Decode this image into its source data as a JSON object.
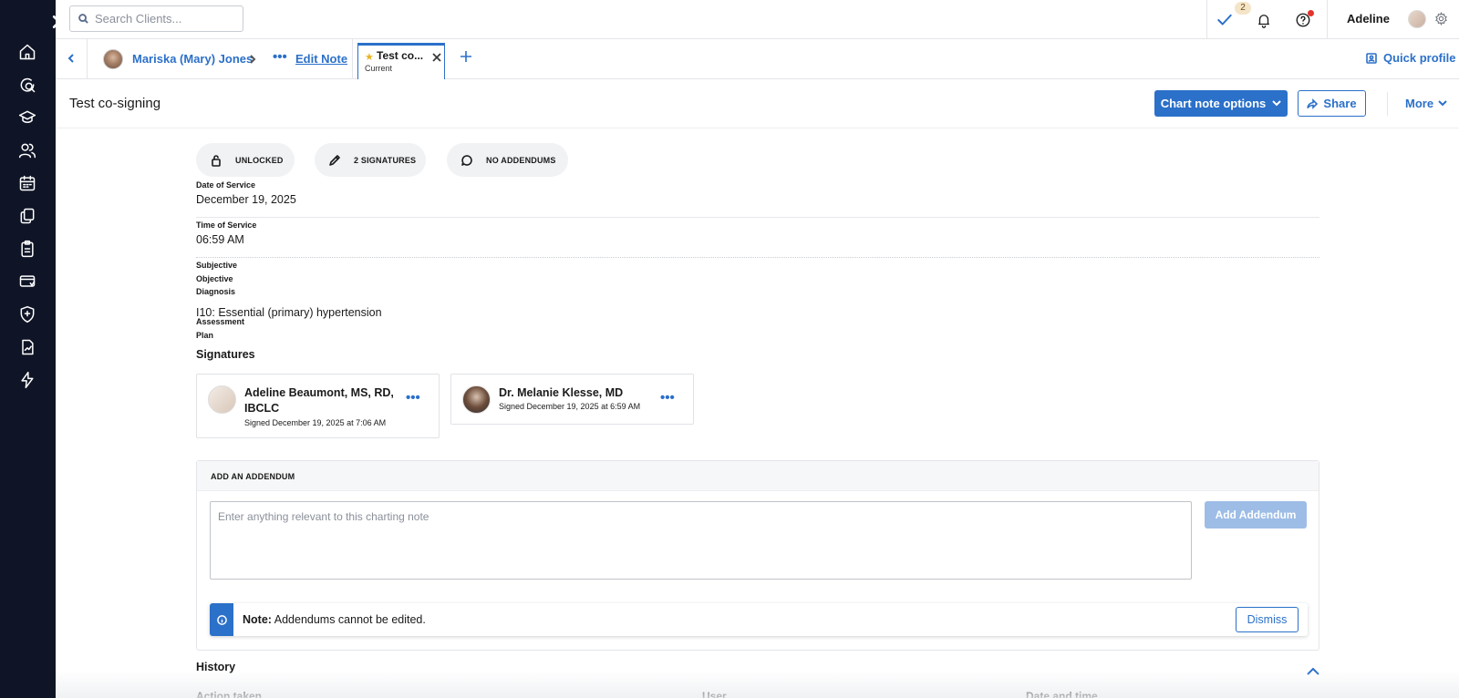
{
  "search": {
    "placeholder": "Search Clients..."
  },
  "topbar": {
    "tasks_count": "2",
    "user_name": "Adeline"
  },
  "tabs": {
    "client_name": "Mariska (Mary) Jones",
    "edit_note_label": "Edit Note",
    "more_dots": "•••",
    "active_tab": {
      "title": "Test co...",
      "subtitle": "Current",
      "star": "★"
    },
    "quick_profile_label": "Quick profile"
  },
  "page": {
    "title": "Test co-signing",
    "chart_note_options_label": "Chart note options",
    "share_label": "Share",
    "more_label": "More"
  },
  "status_pills": [
    {
      "label": "UNLOCKED",
      "icon": "lock-icon"
    },
    {
      "label": "2 SIGNATURES",
      "icon": "pencil-icon"
    },
    {
      "label": "NO ADDENDUMS",
      "icon": "comment-icon"
    }
  ],
  "fields": {
    "date_of_service_label": "Date of Service",
    "date_of_service_value": "December 19, 2025",
    "time_of_service_label": "Time of Service",
    "time_of_service_value": "06:59 AM",
    "subjective_label": "Subjective",
    "objective_label": "Objective",
    "diagnosis_label": "Diagnosis",
    "diagnosis_value": "I10: Essential (primary) hypertension",
    "assessment_label": "Assessment",
    "plan_label": "Plan"
  },
  "signatures": {
    "heading": "Signatures",
    "items": [
      {
        "name": "Adeline Beaumont, MS, RD, IBCLC",
        "signed": "Signed December 19, 2025 at 7:06 AM",
        "menu": "•••"
      },
      {
        "name": "Dr. Melanie Klesse, MD",
        "signed": "Signed December 19, 2025 at 6:59 AM",
        "menu": "•••"
      }
    ]
  },
  "addendum": {
    "heading": "ADD AN ADDENDUM",
    "placeholder": "Enter anything relevant to this charting note",
    "button_label": "Add Addendum",
    "note_prefix": "Note:",
    "note_text": "Addendums cannot be edited.",
    "dismiss_label": "Dismiss"
  },
  "history": {
    "title": "History",
    "columns": [
      "Action taken",
      "User",
      "Date and time"
    ]
  },
  "colors": {
    "accent": "#2b70c9",
    "sidebar_bg": "#0f1526",
    "disabled_button": "#9dbde6",
    "help_badge": "#e5322d"
  },
  "sidebar_icons": [
    "home-icon",
    "search-chat-icon",
    "graduation-cap-icon",
    "users-icon",
    "calendar-icon",
    "documents-icon",
    "clipboard-icon",
    "billing-icon",
    "shield-icon",
    "reports-icon",
    "lightning-icon"
  ]
}
